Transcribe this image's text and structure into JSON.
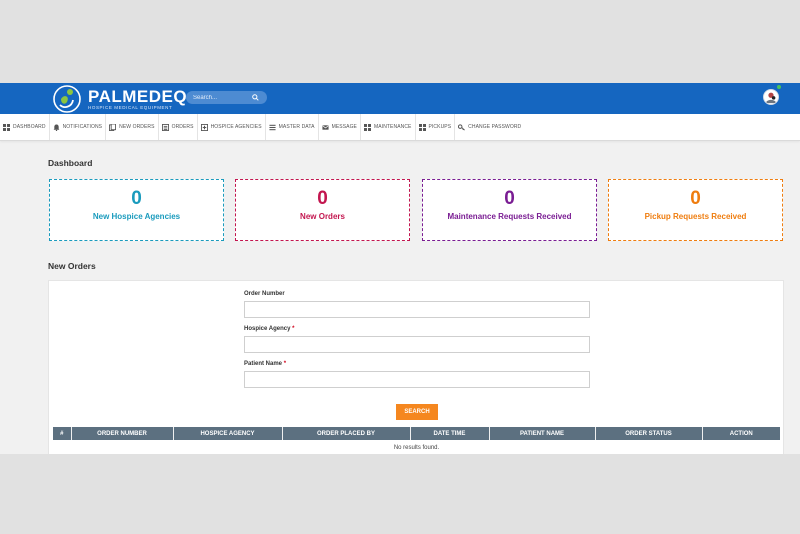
{
  "header": {
    "brand": "PALMEDEQ",
    "tagline": "HOSPICE MEDICAL EQUIPMENT",
    "search_placeholder": "Search...",
    "colors": {
      "bar": "#1566c0"
    }
  },
  "nav": [
    {
      "label": "DASHBOARD",
      "icon": "dashboard-icon"
    },
    {
      "label": "NOTIFICATIONS",
      "icon": "bell-icon"
    },
    {
      "label": "NEW ORDERS",
      "icon": "orders-icon"
    },
    {
      "label": "ORDERS",
      "icon": "list-icon"
    },
    {
      "label": "HOSPICE AGENCIES",
      "icon": "plus-box-icon"
    },
    {
      "label": "MASTER DATA",
      "icon": "menu-icon"
    },
    {
      "label": "MESSAGE",
      "icon": "envelope-icon"
    },
    {
      "label": "MAINTENANCE",
      "icon": "grid-icon"
    },
    {
      "label": "PICKUPS",
      "icon": "grid-icon"
    },
    {
      "label": "CHANGE PASSWORD",
      "icon": "key-icon"
    }
  ],
  "dashboard": {
    "title": "Dashboard",
    "cards": [
      {
        "value": "0",
        "label": "New Hospice Agencies",
        "color": "#1a9bbd"
      },
      {
        "value": "0",
        "label": "New Orders",
        "color": "#c3164f"
      },
      {
        "value": "0",
        "label": "Maintenance Requests Received",
        "color": "#7a1d93"
      },
      {
        "value": "0",
        "label": "Pickup Requests Received",
        "color": "#ef7d0f"
      }
    ]
  },
  "orders": {
    "title": "New Orders",
    "fields": {
      "order_number": {
        "label": "Order Number",
        "value": ""
      },
      "hospice_agency": {
        "label": "Hospice Agency",
        "required": "*",
        "value": ""
      },
      "patient_name": {
        "label": "Patient Name",
        "required": "*",
        "value": ""
      }
    },
    "search_button": "SEARCH",
    "table": {
      "columns": [
        "#",
        "ORDER NUMBER",
        "HOSPICE AGENCY",
        "ORDER PLACED BY",
        "DATE TIME",
        "PATIENT NAME",
        "ORDER STATUS",
        "ACTION"
      ],
      "empty_message": "No results found."
    }
  }
}
